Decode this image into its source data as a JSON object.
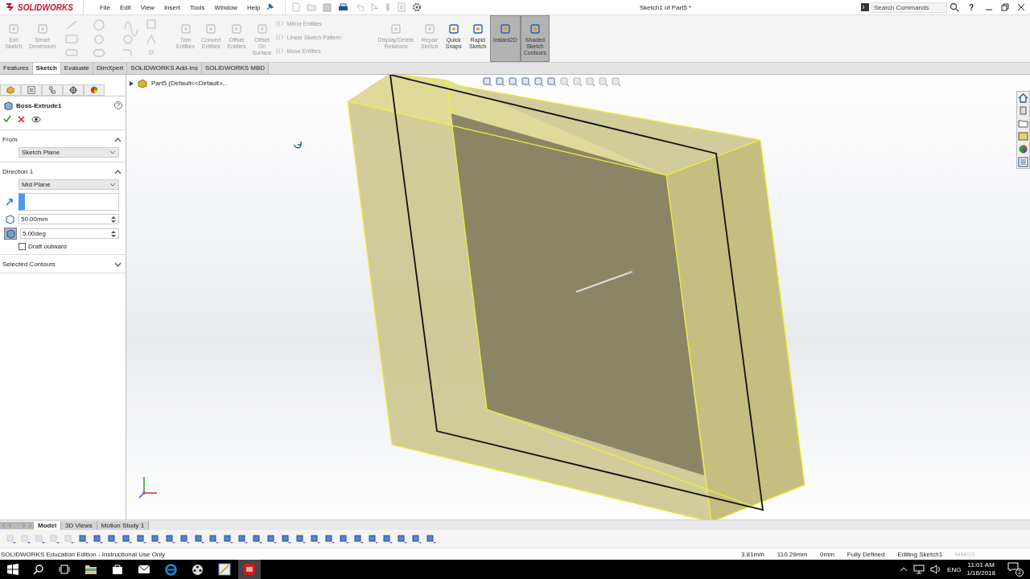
{
  "title_bar": {
    "app": "SOLIDWORKS",
    "menus": [
      "File",
      "Edit",
      "View",
      "Insert",
      "Tools",
      "Window",
      "Help"
    ],
    "document_title": "Sketch1 of Part5 *",
    "search": {
      "placeholder": "Search Commands"
    },
    "help": "?"
  },
  "ribbon": {
    "items": [
      {
        "kind": "large",
        "label": "Exit Sketch",
        "disabled": true,
        "selected": false
      },
      {
        "kind": "large",
        "label": "Smart Dimension",
        "disabled": true,
        "selected": false
      },
      {
        "kind": "grid",
        "disabled": true
      },
      {
        "kind": "large",
        "label": "Trim Entities",
        "disabled": true,
        "selected": false
      },
      {
        "kind": "large",
        "label": "Convert Entities",
        "disabled": true,
        "selected": false
      },
      {
        "kind": "large",
        "label": "Offset Entities",
        "disabled": true,
        "selected": false
      },
      {
        "kind": "large",
        "label": "Offset On Surface",
        "disabled": true,
        "selected": false
      },
      {
        "kind": "small",
        "label": "Mirror Entities",
        "disabled": true
      },
      {
        "kind": "small",
        "label": "Linear Sketch Pattern",
        "disabled": true
      },
      {
        "kind": "small",
        "label": "Move Entities",
        "disabled": true
      },
      {
        "kind": "large",
        "label": "Display/Delete Relations",
        "disabled": true,
        "selected": false
      },
      {
        "kind": "large",
        "label": "Repair Sketch",
        "disabled": true,
        "selected": false
      },
      {
        "kind": "large",
        "label": "Quick Snaps",
        "disabled": false,
        "selected": false
      },
      {
        "kind": "large",
        "label": "Rapid Sketch",
        "disabled": false,
        "selected": false
      },
      {
        "kind": "large",
        "label": "Instant2D",
        "disabled": false,
        "selected": true
      },
      {
        "kind": "large",
        "label": "Shaded Sketch Contours",
        "disabled": false,
        "selected": true
      }
    ]
  },
  "command_tabs": [
    {
      "label": "Features",
      "selected": false
    },
    {
      "label": "Sketch",
      "selected": true
    },
    {
      "label": "Evaluate",
      "selected": false
    },
    {
      "label": "DimXpert",
      "selected": false
    },
    {
      "label": "SOLIDWORKS Add-Ins",
      "selected": false
    },
    {
      "label": "SOLIDWORKS MBD",
      "selected": false
    }
  ],
  "property_manager": {
    "title": "Boss-Extrude1",
    "help": "?",
    "sections": [
      {
        "title": "From",
        "expanded": true,
        "fields": [
          {
            "kind": "select",
            "value": "Sketch Plane"
          }
        ]
      },
      {
        "title": "Direction 1",
        "expanded": true,
        "fields": [
          {
            "kind": "select",
            "value": "Mid Plane"
          },
          {
            "kind": "direction"
          },
          {
            "kind": "spin",
            "value": "50.00mm",
            "toggle_on": false
          },
          {
            "kind": "spin",
            "value": "5.00deg",
            "toggle_on": true
          },
          {
            "kind": "checkbox",
            "label": "Draft outward",
            "checked": false
          }
        ]
      },
      {
        "title": "Selected Contours",
        "expanded": false
      }
    ]
  },
  "feature_tree": {
    "root": "Part5  (Default<<Default>..."
  },
  "bottom_tabs": [
    {
      "label": "Model",
      "selected": true
    },
    {
      "label": "3D Views",
      "selected": false
    },
    {
      "label": "Motion Study 1",
      "selected": false
    }
  ],
  "status_bar": {
    "message": "SOLIDWORKS Education Edition - Instructional Use Only",
    "fields": [
      {
        "text": "3.81mm",
        "dim": false
      },
      {
        "text": "110.29mm",
        "dim": false
      },
      {
        "text": "0mm",
        "dim": false
      },
      {
        "text": "Fully Defined",
        "dim": false
      },
      {
        "text": "Editing Sketch1",
        "dim": false
      },
      {
        "text": "MMGS",
        "dim": true
      }
    ]
  },
  "taskbar": {
    "language": "ENG",
    "time": "11:01 AM",
    "date": "1/16/2018",
    "notifications": "2"
  }
}
